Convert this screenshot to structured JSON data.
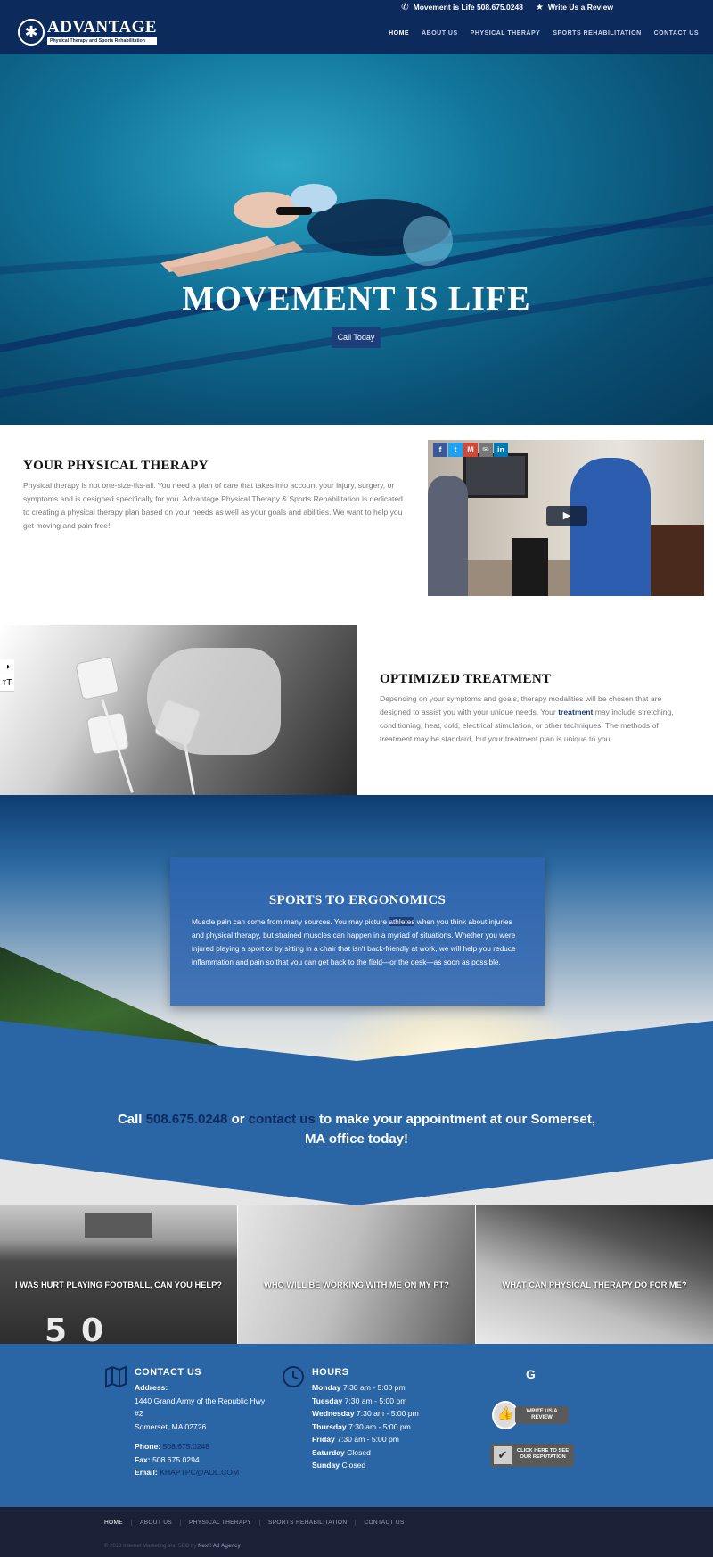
{
  "topbar": {
    "phone_text": "Movement is Life 508.675.0248",
    "review_text": "Write Us a Review",
    "logo": {
      "name": "ADVANTAGE",
      "tagline": "Physical Therapy and Sports Rehabilitation"
    },
    "nav": [
      "HOME",
      "ABOUT US",
      "PHYSICAL THERAPY",
      "SPORTS REHABILITATION",
      "CONTACT US"
    ]
  },
  "hero": {
    "title": "MOVEMENT IS LIFE",
    "cta": "Call Today"
  },
  "physical_therapy": {
    "title": "YOUR PHYSICAL THERAPY",
    "body": "Physical therapy is not one-size-fits-all. You need a plan of care that takes into account your injury, surgery, or symptoms and is designed specifically for you. Advantage Physical Therapy & Sports Rehabilitation is dedicated to creating a physical therapy plan based on your needs as well as your goals and abilities. We want to help you get moving and pain-free!",
    "share_icons": [
      "f",
      "t",
      "M",
      "✉",
      "in"
    ]
  },
  "optimized": {
    "title": "OPTIMIZED TREATMENT",
    "body_pre": "Depending on your symptoms and goals, therapy modalities will be chosen that are designed to assist you with your unique needs. Your ",
    "body_link": "treatment",
    "body_post": " may include stretching, conditioning, heat, cold, electrical stimulation, or other techniques. The methods of treatment may be standard, but your treatment plan is unique to you."
  },
  "sports": {
    "title": "SPORTS TO ERGONOMICS",
    "body_pre": "Muscle pain can come from many sources. You may picture ",
    "body_link": "athletes",
    "body_post": " when you think about injuries and physical therapy, but strained muscles can happen in a myriad of situations. Whether you were injured playing a sport or by sitting in a chair that isn't back-friendly at work, we will help you reduce inflammation and pain so that you can get back to the field—or the desk—as soon as possible."
  },
  "callout": {
    "pre": "Call ",
    "phone": "508.675.0248",
    "mid": " or ",
    "contact": "contact us",
    "post": " to make your appointment at our Somerset, MA office today!"
  },
  "tiles": [
    {
      "label": "I WAS HURT PLAYING FOOTBALL, CAN YOU HELP?",
      "number": "50"
    },
    {
      "label": "WHO WILL BE WORKING WITH ME ON MY PT?"
    },
    {
      "label": "WHAT CAN PHYSICAL THERAPY DO FOR ME?"
    }
  ],
  "contact": {
    "title": "CONTACT US",
    "address_label": "Address:",
    "address_line1": "1440 Grand Army of the Republic Hwy",
    "address_line2": "#2",
    "address_line3": "Somerset, MA 02726",
    "phone_label": "Phone:",
    "phone": "508.675.0248",
    "fax_label": "Fax:",
    "fax": "508.675.0294",
    "email_label": "Email:",
    "email": "KHAPTPC@AOL.COM"
  },
  "hours": {
    "title": "HOURS",
    "days": [
      {
        "day": "Monday",
        "time": "7:30 am - 5:00 pm"
      },
      {
        "day": "Tuesday",
        "time": "7:30 am - 5:00 pm"
      },
      {
        "day": "Wednesday",
        "time": "7:30 am - 5:00 pm"
      },
      {
        "day": "Thursday",
        "time": "7:30 am - 5:00 pm"
      },
      {
        "day": "Friday",
        "time": "7:30 am - 5:00 pm"
      },
      {
        "day": "Saturday",
        "time": "Closed"
      },
      {
        "day": "Sunday",
        "time": "Closed"
      }
    ]
  },
  "reviews": {
    "google": "G",
    "write_review": "WRITE US A REVIEW",
    "reputation_line1": "CLICK HERE TO SEE",
    "reputation_line2": "OUR REPUTATION"
  },
  "footer": {
    "nav": [
      "HOME",
      "ABOUT US",
      "PHYSICAL THERAPY",
      "SPORTS REHABILITATION",
      "CONTACT US"
    ],
    "copyright_pre": "© 2018 Internet Marketing and SEO by ",
    "copyright_brand": "Next! Ad Agency"
  }
}
